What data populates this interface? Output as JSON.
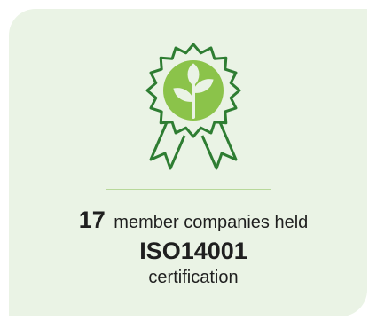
{
  "stat": {
    "count": "17",
    "count_suffix": "member companies held",
    "standard": "ISO14001",
    "label": "certification"
  },
  "colors": {
    "card_background": "#eaf3e5",
    "badge_outline": "#2e7d32",
    "badge_circle": "#8bc34a",
    "divider": "#b8d89a",
    "text": "#1f1f1f"
  },
  "icons": {
    "badge": "award-ribbon-seedling-icon"
  }
}
